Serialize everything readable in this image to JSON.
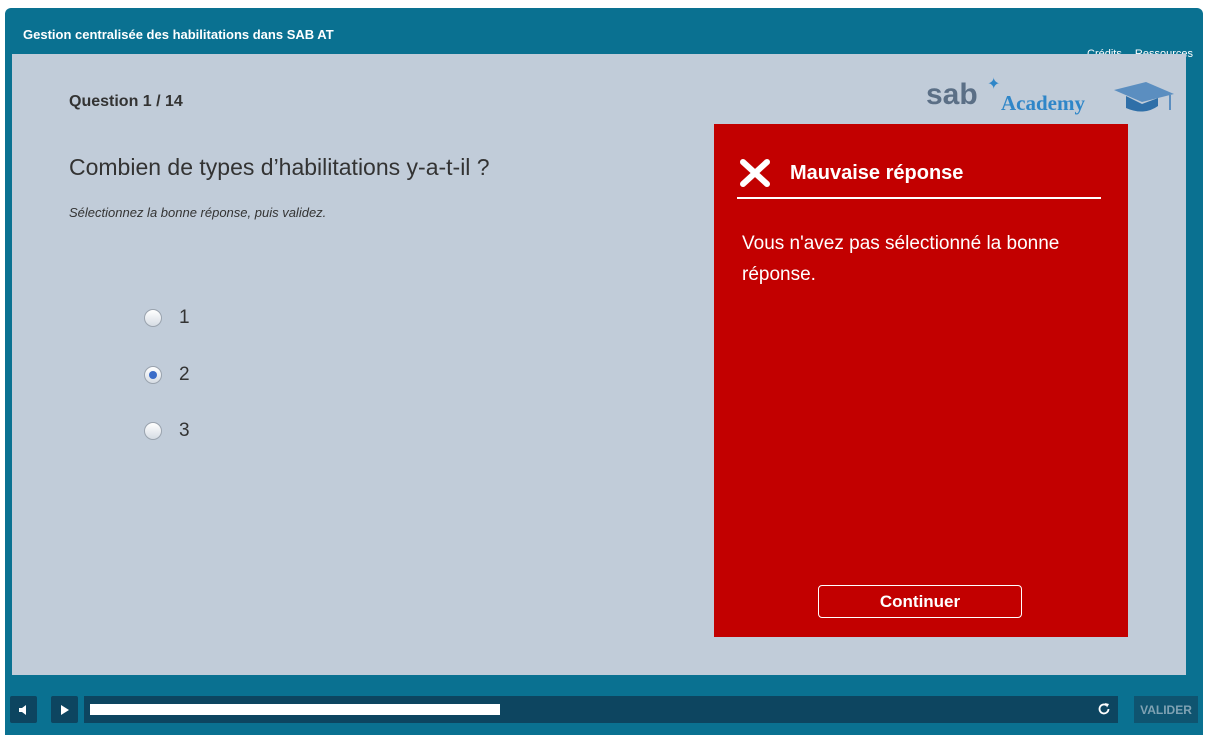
{
  "header": {
    "title": "Gestion centralisée des habilitations dans SAB AT",
    "links": [
      "Crédits",
      "Ressources"
    ]
  },
  "question": {
    "number": "Question 1 / 14",
    "text": "Combien de types d’habilitations y-a-t-il ?",
    "instruction": "Sélectionnez la bonne réponse, puis validez.",
    "options": [
      {
        "label": "1",
        "selected": false
      },
      {
        "label": "2",
        "selected": true
      },
      {
        "label": "3",
        "selected": false
      }
    ]
  },
  "logo": {
    "brand": "sab",
    "product": "Academy",
    "icons": [
      "star-icon",
      "graduation-cap-icon"
    ]
  },
  "feedback": {
    "icon": "close-x-icon",
    "title": "Mauvaise réponse",
    "message": "Vous n'avez pas sélectionné la bonne réponse.",
    "continue_label": "Continuer",
    "background": "#c20000"
  },
  "controls": {
    "icons": [
      "volume-icon",
      "play-icon",
      "reload-icon"
    ],
    "progress_fraction": 0.41,
    "submit_label": "VALIDER"
  },
  "colors": {
    "header": "#0a7191",
    "stage": "#c1ccd9",
    "accent": "#2f86c8"
  }
}
